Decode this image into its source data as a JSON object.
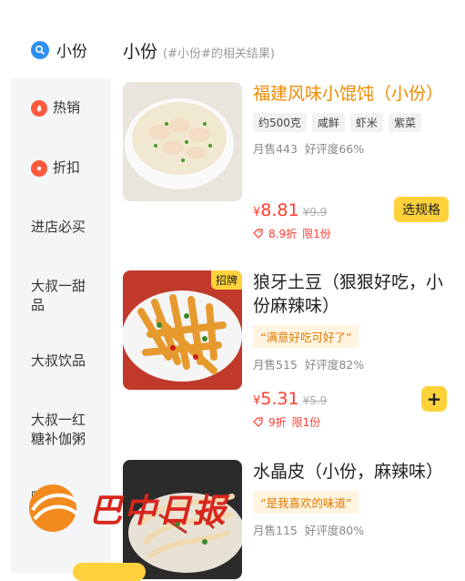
{
  "search_category": {
    "label": "小份",
    "icon": "search-icon"
  },
  "results": {
    "title": "小份",
    "subtitle": "(#小份#的相关结果)"
  },
  "sidebar": {
    "items": [
      {
        "label": "热销",
        "icon": "fire-icon"
      },
      {
        "label": "折扣",
        "icon": "discount-icon"
      },
      {
        "label": "进店必买"
      },
      {
        "label": "大叔一甜品"
      },
      {
        "label": "大叔饮品"
      },
      {
        "label": "大叔一红糖补伽粥"
      },
      {
        "label": "贼"
      }
    ]
  },
  "products": [
    {
      "name": "福建风味小馄饨（小份）",
      "tags": [
        "约500克",
        "咸鲜",
        "虾米",
        "紫菜"
      ],
      "monthly_sales": "月售443",
      "rating": "好评度66%",
      "price": "8.81",
      "original_price": "¥9.9",
      "discount": "8.9折",
      "limit": "限1份",
      "button": "选规格"
    },
    {
      "name": "狼牙土豆（狠狠好吃，小份麻辣味）",
      "badge": "招牌",
      "quote": "“满意好吃可好了”",
      "monthly_sales": "月售515",
      "rating": "好评度82%",
      "price": "5.31",
      "original_price": "¥5.9",
      "discount": "9折",
      "limit": "限1份",
      "button": "+"
    },
    {
      "name": "水晶皮（小份，麻辣味）",
      "quote": "“是我喜欢的味道”",
      "monthly_sales": "月售115",
      "rating": "好评度80%"
    }
  ],
  "watermark": {
    "text": "巴中日报"
  },
  "colors": {
    "accent": "#ffd23c",
    "price": "#ff3c2f",
    "highlight": "#f08a00"
  }
}
